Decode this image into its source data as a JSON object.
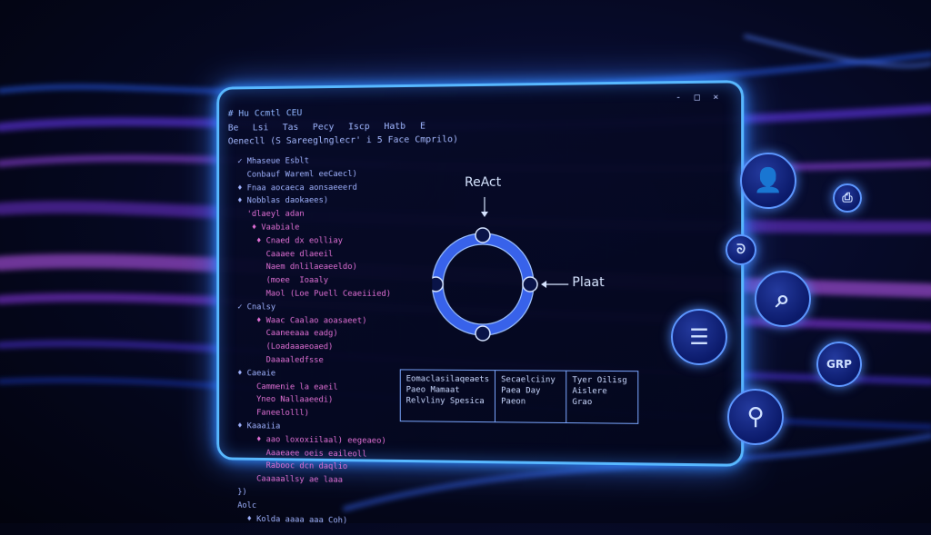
{
  "window": {
    "title": "# Hu Ccmtl CEU",
    "menu": [
      "Be",
      "Lsi",
      "Tas",
      "Pecy",
      "Iscp",
      "Hatb",
      "E"
    ],
    "subtitle": "Oenecll (S Sareeglnglecr' i 5 Face Cmprilo)",
    "buttons": [
      "-",
      "□",
      "×"
    ]
  },
  "code_lines": [
    {
      "t": "  ✓ Mhaseue Esblt",
      "c": "b"
    },
    {
      "t": "    Conbauf Wareml eeCaecl)",
      "c": "b"
    },
    {
      "t": "  ♦ Fnaa aocaeca aonsaeeerd",
      "c": "b"
    },
    {
      "t": "  ♦ Nobblas daokaees)",
      "c": "b"
    },
    {
      "t": "    'dlaeyl adan",
      "c": "m"
    },
    {
      "t": "     ♦ Vaabiale",
      "c": "m"
    },
    {
      "t": "      ♦ Cnaed dx eolliay",
      "c": "m"
    },
    {
      "t": "        Caaaee dlaeeil",
      "c": "m"
    },
    {
      "t": "        Naem dnlilaeaeeldo)",
      "c": "m"
    },
    {
      "t": "        (moee  Ioaaly",
      "c": "m"
    },
    {
      "t": "        Maol (Loe Puell Ceaeiiied)",
      "c": "m"
    },
    {
      "t": "  ✓ Cnalsy",
      "c": "b"
    },
    {
      "t": "      ♦ Waac Caalao aoasaeet)",
      "c": "m"
    },
    {
      "t": "        Caaneeaaa eadg)",
      "c": "m"
    },
    {
      "t": "        (Loadaaaeoaed)",
      "c": "m"
    },
    {
      "t": "        Daaaaledfsse",
      "c": "m"
    },
    {
      "t": "  ♦ Caeaie",
      "c": "b"
    },
    {
      "t": "      Cammenie la eaeil",
      "c": "m"
    },
    {
      "t": "      Yneo Nallaaeedi)",
      "c": "m"
    },
    {
      "t": "      Faneelolll)",
      "c": "m"
    },
    {
      "t": "  ♦ Kaaaiia",
      "c": "b"
    },
    {
      "t": "      ♦ aao loxoxiilaal) eegeaeo)",
      "c": "m"
    },
    {
      "t": "        Aaaeaee oeis eaileoll",
      "c": "m"
    },
    {
      "t": "        Rabooc dcn daqlio",
      "c": "m"
    },
    {
      "t": "      Caaaaallsy ae laaa",
      "c": "m"
    },
    {
      "t": "  })",
      "c": "b"
    },
    {
      "t": "  Aolc",
      "c": "b"
    },
    {
      "t": "    ♦ Kolda aaaa aaa Coh)",
      "c": "b"
    }
  ],
  "diagram": {
    "top_label": "ReAct",
    "right_label": "Plaat"
  },
  "table": [
    "Eomaclasilaqeaets\nPaeo Mamaat\nRelvliny Spesica",
    "Secaelciiny\nPaea Day\nPaeon",
    "Tyer Oilisg\nAislere\nGrao"
  ],
  "bubbles": [
    {
      "name": "user-icon",
      "text": "👤"
    },
    {
      "name": "document-icon",
      "text": "⎙"
    },
    {
      "name": "chat-icon",
      "text": "ᘐ"
    },
    {
      "name": "search-icon",
      "text": "⌕"
    },
    {
      "name": "clipboard-icon",
      "text": "☰"
    },
    {
      "name": "grp-badge",
      "text": "GRP"
    },
    {
      "name": "magnifier-icon",
      "text": "⚲"
    }
  ]
}
